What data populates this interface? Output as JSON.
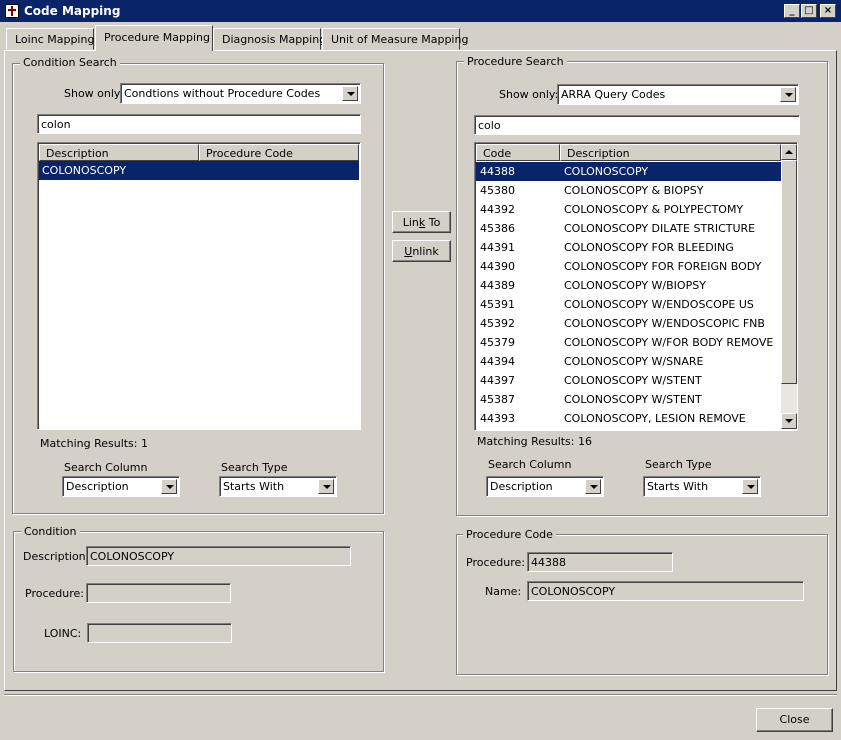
{
  "window": {
    "title": "Code Mapping",
    "min_icon": "minimize-icon",
    "max_icon": "maximize-icon",
    "close_icon": "close-icon"
  },
  "tabs": [
    {
      "label": "Loinc Mapping"
    },
    {
      "label": "Procedure  Mapping",
      "active": true
    },
    {
      "label": "Diagnosis Mapping"
    },
    {
      "label": "Unit of Measure Mapping"
    }
  ],
  "condition_search": {
    "legend": "Condition Search",
    "show_only_label": "Show only:",
    "show_only_value": "Condtions without Procedure Codes",
    "search_text": "colon",
    "columns": [
      "Description",
      "Procedure Code"
    ],
    "rows": [
      {
        "description": "COLONOSCOPY",
        "procedure_code": "",
        "selected": true
      }
    ],
    "matching": "Matching Results: 1",
    "search_column_label": "Search Column",
    "search_column_value": "Description",
    "search_type_label": "Search Type",
    "search_type_value": "Starts With"
  },
  "actions": {
    "link_pre": "Lin",
    "link_u": "k",
    "link_post": " To",
    "unlink_u": "U",
    "unlink_post": "nlink"
  },
  "procedure_search": {
    "legend": "Procedure Search",
    "show_only_label": "Show only:",
    "show_only_value": "ARRA Query Codes",
    "search_text": "colo",
    "columns": [
      "Code",
      "Description"
    ],
    "rows": [
      {
        "code": "44388",
        "description": "COLONOSCOPY",
        "selected": true
      },
      {
        "code": "45380",
        "description": "COLONOSCOPY & BIOPSY"
      },
      {
        "code": "44392",
        "description": "COLONOSCOPY & POLYPECTOMY"
      },
      {
        "code": "45386",
        "description": "COLONOSCOPY DILATE STRICTURE"
      },
      {
        "code": "44391",
        "description": "COLONOSCOPY FOR BLEEDING"
      },
      {
        "code": "44390",
        "description": "COLONOSCOPY FOR FOREIGN BODY"
      },
      {
        "code": "44389",
        "description": "COLONOSCOPY W/BIOPSY"
      },
      {
        "code": "45391",
        "description": "COLONOSCOPY W/ENDOSCOPE US"
      },
      {
        "code": "45392",
        "description": "COLONOSCOPY W/ENDOSCOPIC FNB"
      },
      {
        "code": "45379",
        "description": "COLONOSCOPY W/FOR BODY REMOVE"
      },
      {
        "code": "44394",
        "description": "COLONOSCOPY W/SNARE"
      },
      {
        "code": "44397",
        "description": "COLONOSCOPY W/STENT"
      },
      {
        "code": "45387",
        "description": "COLONOSCOPY W/STENT"
      },
      {
        "code": "44393",
        "description": "COLONOSCOPY, LESION REMOVE"
      }
    ],
    "matching": "Matching Results: 16",
    "search_column_label": "Search Column",
    "search_column_value": "Description",
    "search_type_label": "Search Type",
    "search_type_value": "Starts With"
  },
  "condition": {
    "legend": "Condition",
    "description_label": "Description:",
    "description_value": "COLONOSCOPY",
    "procedure_label": "Procedure:",
    "procedure_value": "",
    "loinc_label": "LOINC:",
    "loinc_value": ""
  },
  "procedure_code": {
    "legend": "Procedure Code",
    "procedure_label": "Procedure:",
    "procedure_value": "44388",
    "name_label": "Name:",
    "name_value": "COLONOSCOPY"
  },
  "footer": {
    "close_label": "Close"
  }
}
